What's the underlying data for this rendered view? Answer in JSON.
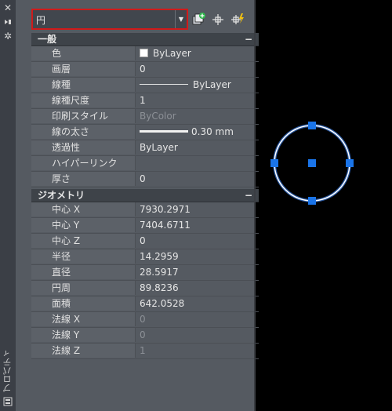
{
  "sidebar": {
    "title": "プロパティ"
  },
  "selector": {
    "value": "円"
  },
  "sections": {
    "general": {
      "title": "一般",
      "toggle": "−",
      "rows": [
        {
          "label": "色",
          "value": "ByLayer"
        },
        {
          "label": "画層",
          "value": "0"
        },
        {
          "label": "線種",
          "value": "ByLayer"
        },
        {
          "label": "線種尺度",
          "value": "1"
        },
        {
          "label": "印刷スタイル",
          "value": "ByColor"
        },
        {
          "label": "線の太さ",
          "value": "0.30 mm"
        },
        {
          "label": "透過性",
          "value": "ByLayer"
        },
        {
          "label": "ハイパーリンク",
          "value": ""
        },
        {
          "label": "厚さ",
          "value": "0"
        }
      ]
    },
    "geometry": {
      "title": "ジオメトリ",
      "toggle": "−",
      "rows": [
        {
          "label": "中心 X",
          "value": "7930.2971"
        },
        {
          "label": "中心 Y",
          "value": "7404.6711"
        },
        {
          "label": "中心 Z",
          "value": "0"
        },
        {
          "label": "半径",
          "value": "14.2959"
        },
        {
          "label": "直径",
          "value": "28.5917"
        },
        {
          "label": "円周",
          "value": "89.8236"
        },
        {
          "label": "面積",
          "value": "642.0528"
        },
        {
          "label": "法線 X",
          "value": "0"
        },
        {
          "label": "法線 Y",
          "value": "0"
        },
        {
          "label": "法線 Z",
          "value": "1"
        }
      ]
    }
  },
  "colors": {
    "selection_highlight": "#d01a1a",
    "grip": "#1a74e8",
    "circle_stroke": "#ffffff",
    "circle_glow": "#3d7fe6"
  }
}
